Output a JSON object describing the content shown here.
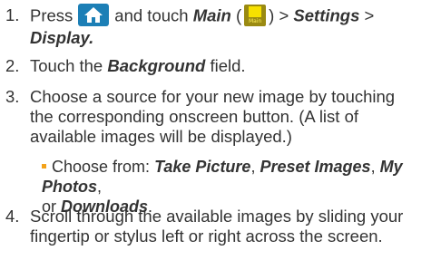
{
  "steps": [
    {
      "number": "1.",
      "press": "Press",
      "home_icon": "home-icon",
      "and_touch": "and touch",
      "main": "Main",
      "open_paren": "(",
      "main_icon": "main-menu-icon",
      "main_icon_caption": "Main",
      "close_paren": ") >",
      "settings": "Settings",
      "gt": ">",
      "display": "Display."
    },
    {
      "number": "2.",
      "touch_the": "Touch the",
      "background": "Background",
      "field": "field."
    },
    {
      "number": "3.",
      "line1": "Choose a source for your new image by touching",
      "line2": "the corresponding onscreen button. (A list of",
      "line3": "available images will be displayed.)"
    },
    {
      "number": "4.",
      "line1": "Scroll through the available images by sliding your",
      "line2": "fingertip or stylus left or right across the screen."
    }
  ],
  "sub_bullet": {
    "choose_from": "Choose from:",
    "take_picture": "Take Picture",
    "comma1": ",",
    "preset_images": "Preset Images",
    "comma2": ",",
    "my_photos": "My Photos",
    "comma3": ",",
    "or": "or",
    "downloads": "Downloads",
    "period": "."
  },
  "colors": {
    "text": "#333333",
    "bullet": "#f3a21a",
    "home_icon_bg": "#1c7fb6",
    "main_icon_bg": "#9a8a12"
  }
}
